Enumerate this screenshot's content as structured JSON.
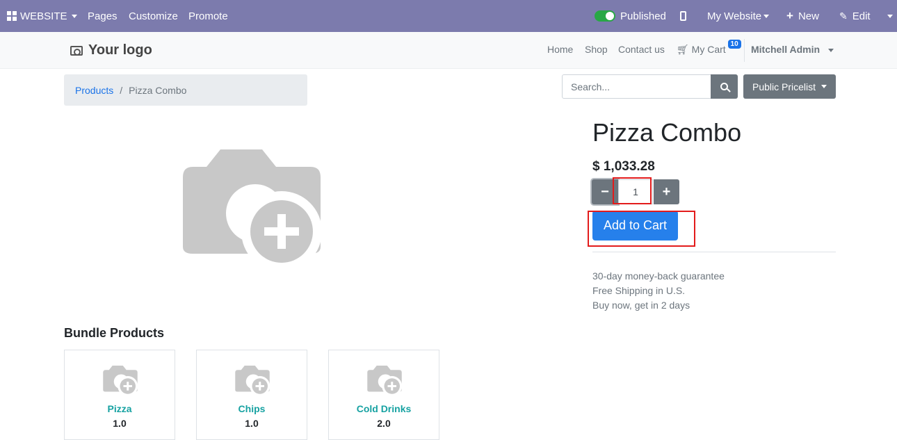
{
  "admin_bar": {
    "website_label": "WEBSITE",
    "pages_label": "Pages",
    "customize_label": "Customize",
    "promote_label": "Promote",
    "published_label": "Published",
    "my_website_label": "My Website",
    "new_label": "New",
    "edit_label": "Edit"
  },
  "header": {
    "logo_text": "Your logo",
    "nav": [
      "Home",
      "Shop",
      "Contact us"
    ],
    "cart_label": "My Cart",
    "cart_count": "10",
    "user_name": "Mitchell Admin"
  },
  "breadcrumb": {
    "parent": "Products",
    "separator": "/",
    "current": "Pizza Combo"
  },
  "search": {
    "placeholder": "Search..."
  },
  "pricelist_label": "Public Pricelist",
  "product": {
    "name": "Pizza Combo",
    "price": "$ 1,033.28",
    "quantity": "1",
    "minus_label": "−",
    "plus_label": "+",
    "add_to_cart_label": "Add to Cart",
    "info_lines": [
      "30-day money-back guarantee",
      "Free Shipping in U.S.",
      "Buy now, get in 2 days"
    ]
  },
  "bundle": {
    "heading": "Bundle Products",
    "items": [
      {
        "name": "Pizza",
        "qty": "1.0"
      },
      {
        "name": "Chips",
        "qty": "1.0"
      },
      {
        "name": "Cold Drinks",
        "qty": "2.0"
      }
    ]
  },
  "colors": {
    "admin_bar": "#7c7bad",
    "primary": "#2680eb",
    "secondary_button": "#6c757d",
    "highlight_box": "#e31b1b",
    "bundle_name": "#17a2a2"
  }
}
